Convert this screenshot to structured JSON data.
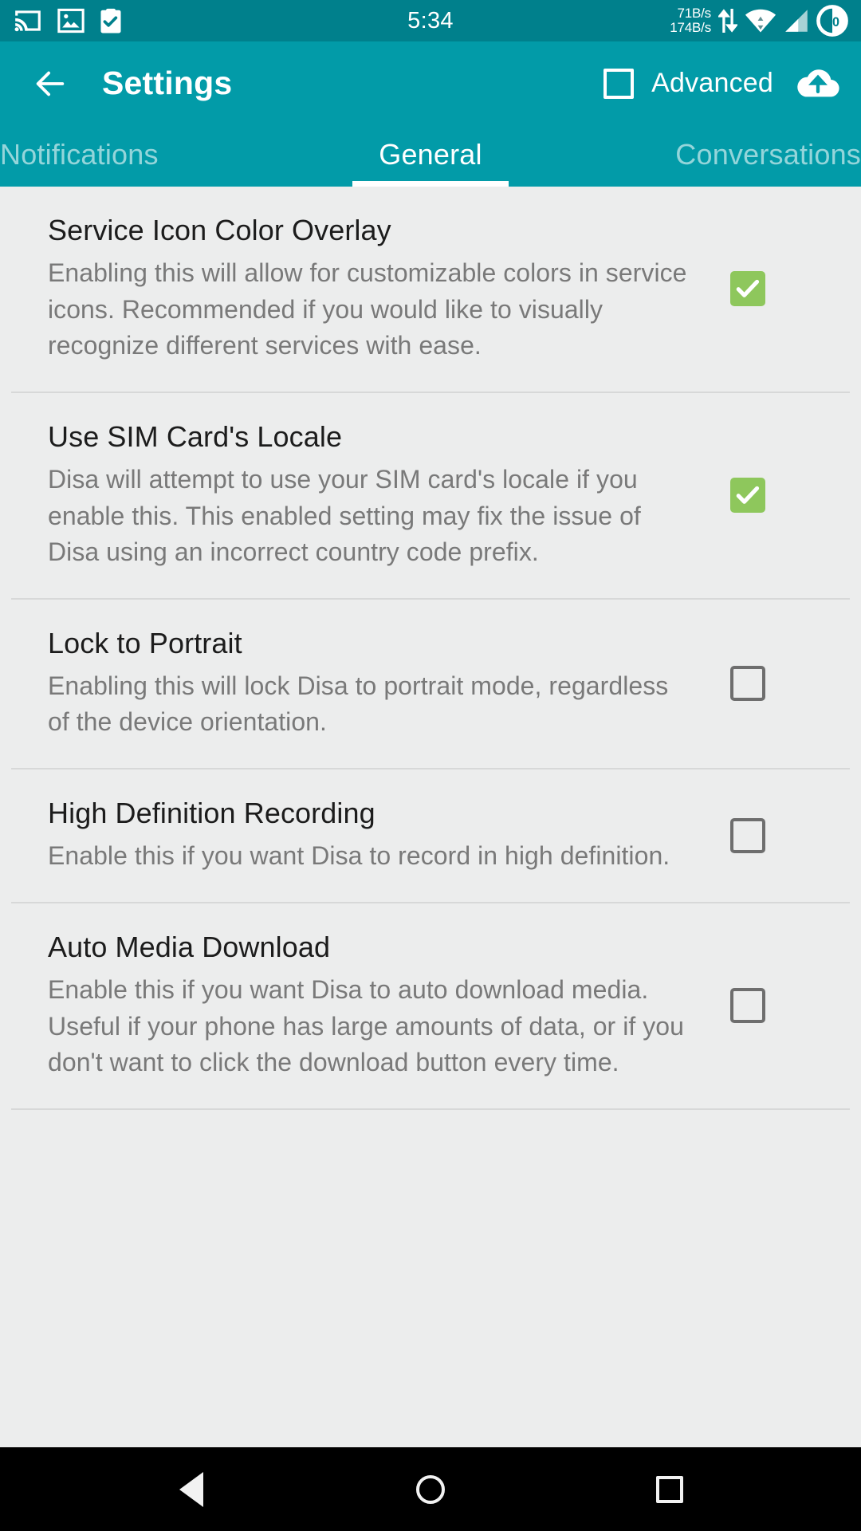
{
  "status_bar": {
    "time": "5:34",
    "network_speed_up": "71B/s",
    "network_speed_down": "174B/s",
    "battery_level": "50",
    "icons": [
      "cast-icon",
      "photo-icon",
      "clipboard-check-icon",
      "data-transfer-icon",
      "wifi-icon",
      "cellular-signal-icon",
      "battery-circle-icon"
    ],
    "background_color": "#00808c"
  },
  "toolbar": {
    "back_label": "back-arrow-icon",
    "title": "Settings",
    "advanced_label": "Advanced",
    "advanced_checked": false,
    "upload_label": "cloud-upload-icon",
    "background_color": "#029ba8"
  },
  "tabs": {
    "items": [
      {
        "label": "Notifications",
        "active": false
      },
      {
        "label": "General",
        "active": true
      },
      {
        "label": "Conversations",
        "active": false
      }
    ],
    "indicator_color": "#ffffff"
  },
  "preferences": {
    "checked_color": "#8ec75c",
    "unchecked_border_color": "#6e6e6e",
    "items": [
      {
        "title": "Service Icon Color Overlay",
        "summary": "Enabling this will allow for customizable colors in service icons. Recommended if you would like to visually recognize different services with ease.",
        "checked": true
      },
      {
        "title": "Use SIM Card's Locale",
        "summary": "Disa will attempt to use your SIM card's locale if you enable this. This enabled setting may fix the issue of Disa using an incorrect country code prefix.",
        "checked": true
      },
      {
        "title": "Lock to Portrait",
        "summary": "Enabling this will lock Disa to portrait mode, regardless of the device orientation.",
        "checked": false
      },
      {
        "title": "High Definition Recording",
        "summary": "Enable this if you want Disa to record in high definition.",
        "checked": false
      },
      {
        "title": "Auto Media Download",
        "summary": "Enable this if you want Disa to auto download media. Useful if your phone has large amounts of data, or if you don't want to click the download button every time.",
        "checked": false
      }
    ]
  },
  "navigation_bar": {
    "back": "nav-back-icon",
    "home": "nav-home-icon",
    "recents": "nav-recents-icon"
  }
}
